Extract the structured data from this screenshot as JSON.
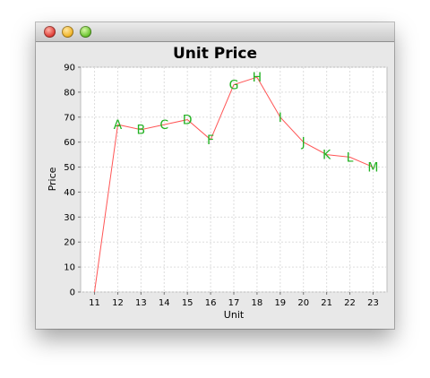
{
  "window": {
    "title": ""
  },
  "colors": {
    "line": "#ff5555",
    "point_label": "#22b222",
    "plot_bg": "#ffffff",
    "grid": "#dddddd"
  },
  "chart_data": {
    "type": "line",
    "title": "Unit Price",
    "xlabel": "Unit",
    "ylabel": "Price",
    "xlim": [
      10.4,
      23.6
    ],
    "ylim": [
      0,
      90
    ],
    "x_ticks": [
      11,
      12,
      13,
      14,
      15,
      16,
      17,
      18,
      19,
      20,
      21,
      22,
      23
    ],
    "y_ticks": [
      0,
      10,
      20,
      30,
      40,
      50,
      60,
      70,
      80,
      90
    ],
    "grid": true,
    "series": [
      {
        "points": [
          {
            "x": 11,
            "y": 0,
            "label": ""
          },
          {
            "x": 12,
            "y": 67,
            "label": "A"
          },
          {
            "x": 13,
            "y": 65,
            "label": "B"
          },
          {
            "x": 14,
            "y": 67,
            "label": "C"
          },
          {
            "x": 15,
            "y": 69,
            "label": "D"
          },
          {
            "x": 16,
            "y": 61,
            "label": "F"
          },
          {
            "x": 17,
            "y": 83,
            "label": "G"
          },
          {
            "x": 18,
            "y": 86,
            "label": "H"
          },
          {
            "x": 19,
            "y": 70,
            "label": "I"
          },
          {
            "x": 20,
            "y": 60,
            "label": "J"
          },
          {
            "x": 21,
            "y": 55,
            "label": "K"
          },
          {
            "x": 22,
            "y": 54,
            "label": "L"
          },
          {
            "x": 23,
            "y": 50,
            "label": "M"
          }
        ]
      }
    ]
  }
}
